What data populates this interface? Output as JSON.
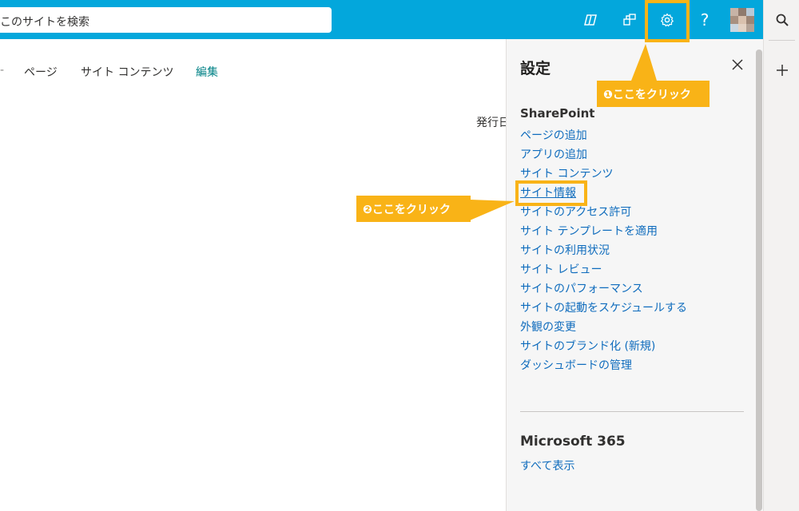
{
  "header": {
    "search_placeholder": "このサイトを検索",
    "help_label": "?",
    "icons": [
      "copilot-icon",
      "share-icon",
      "settings-icon",
      "help-icon",
      "avatar"
    ]
  },
  "command_bar": {
    "items": [
      "ページ",
      "サイト コンテンツ",
      "編集"
    ],
    "publish_label": "発行日"
  },
  "settings_panel": {
    "title": "設定",
    "sharepoint_section": {
      "title": "SharePoint",
      "links": [
        "ページの追加",
        "アプリの追加",
        "サイト コンテンツ",
        "サイト情報",
        "サイトのアクセス許可",
        "サイト テンプレートを適用",
        "サイトの利用状況",
        "サイト レビュー",
        "サイトのパフォーマンス",
        "サイトの起動をスケジュールする",
        "外観の変更",
        "サイトのブランド化 (新規)",
        "ダッシュボードの管理"
      ]
    },
    "m365_section": {
      "title": "Microsoft 365",
      "show_all": "すべて表示"
    }
  },
  "annotations": {
    "callout1": "❶ここをクリック",
    "callout2": "❷ここをクリック"
  },
  "colors": {
    "suite_bar": "#03a7dc",
    "link": "#0f6cbd",
    "highlight": "#f9b317",
    "edit_accent": "#038387"
  }
}
